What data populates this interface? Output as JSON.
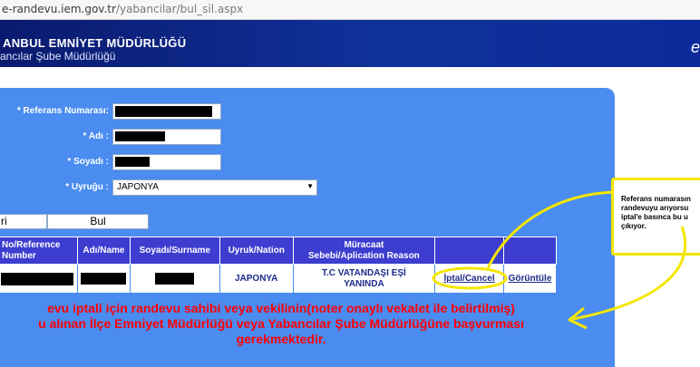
{
  "browser": {
    "url_host": "e-randevu.iem.gov.tr",
    "url_path": "/yabancilar/bul_sil.aspx"
  },
  "header": {
    "title": "ANBUL EMNİYET MÜDÜRLÜĞÜ",
    "subtitle": "ancılar Şube Müdürlüğü",
    "brand": "e"
  },
  "form": {
    "ref_label": "* Referans Numarası:",
    "name_label": "* Adı :",
    "surname_label": "* Soyadı :",
    "nationality_label": "* Uyruğu :",
    "nationality_value": "JAPONYA",
    "tab_left": "ri",
    "find_button": "Bul"
  },
  "table": {
    "headers": [
      "No/Reference\nNumber",
      "Adı/Name",
      "Soyadı/Surname",
      "Uyruk/Nation",
      "Müracaat\nSebebi/Aplication Reason",
      "",
      ""
    ],
    "row": {
      "nation": "JAPONYA",
      "reason": "T.C VATANDAŞI EŞİ\nYANINDA",
      "cancel_link": "İptal/Cancel",
      "view_link": "Görüntüle"
    }
  },
  "warning": {
    "line1": "evu iptali için randevu sahibi veya vekilinin(noter onaylı vekalet ile belirtilmiş)",
    "line2": "u alınan İlçe Emniyet Müdürlüğü veya Yabancılar Şube Müdürlüğüne başvurması",
    "line3": "gerekmektedir."
  },
  "callout": {
    "line1": "Referans numarasın",
    "line2": "randevuyu arıyorsu",
    "line3": "iptal'e basınca bu u",
    "line4": "çıkıyor."
  },
  "colors": {
    "panel": "#4a8cf0",
    "table_header": "#3d3dd0",
    "warning": "#ff0000",
    "annotation": "#f5e600"
  }
}
